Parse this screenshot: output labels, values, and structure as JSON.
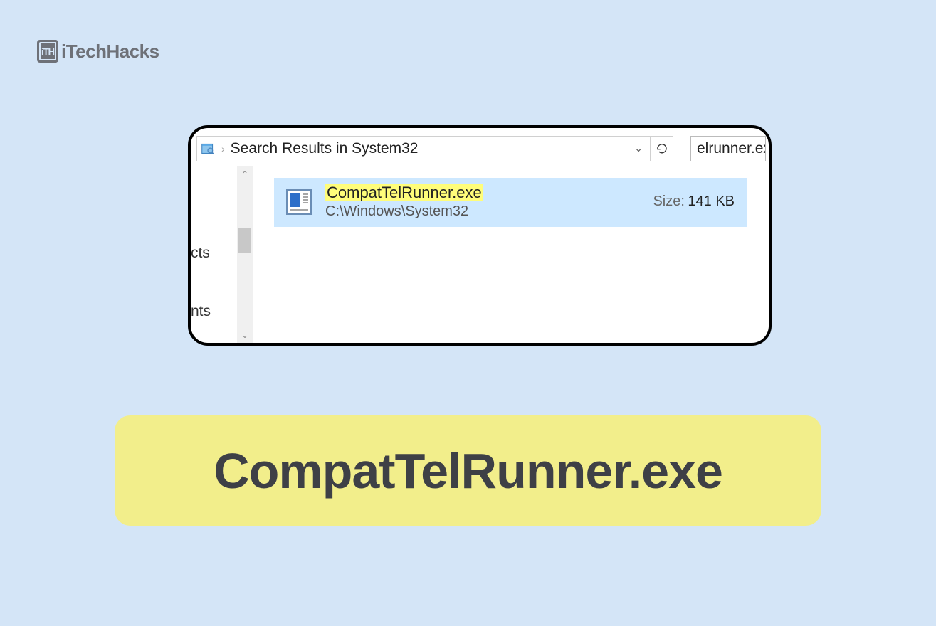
{
  "logo": {
    "badge_text": "iTH",
    "text": "iTechHacks"
  },
  "window": {
    "address_bar": {
      "text": "Search Results in System32"
    },
    "search_box": {
      "text": "elrunner.ex"
    },
    "sidebar": {
      "item1": "cts",
      "item2": "nts"
    },
    "result": {
      "file_name": "CompatTelRunner.exe",
      "file_path": "C:\\Windows\\System32",
      "size_label": "Size:",
      "size_value": "141 KB"
    }
  },
  "title_banner": {
    "text": "CompatTelRunner.exe"
  },
  "icons": {
    "search_folder": "search-folder-icon",
    "refresh": "refresh-icon",
    "exe_file": "exe-file-icon"
  }
}
